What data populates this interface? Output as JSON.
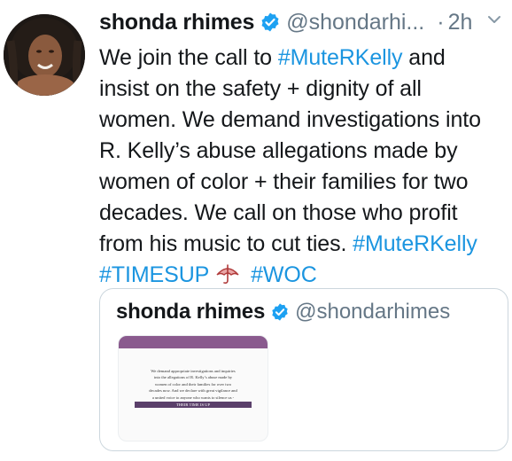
{
  "tweet": {
    "author_name": "shonda rhimes",
    "handle": "@shondarhi...",
    "dot": "·",
    "time": "2h",
    "lines": [
      [
        {
          "t": "We join the call to "
        },
        {
          "t": "#MuteRKelly",
          "h": true
        },
        {
          "t": " and"
        }
      ],
      [
        {
          "t": "insist on the safety + dignity of all"
        }
      ],
      [
        {
          "t": "women. We demand investigations into"
        }
      ],
      [
        {
          "t": "R. Kelly’s abuse allegations made by"
        }
      ],
      [
        {
          "t": "women of color + their families for two"
        }
      ],
      [
        {
          "t": "decades. We call on those who profit"
        }
      ],
      [
        {
          "t": "from his music to cut ties. "
        },
        {
          "t": "#MuteRKelly",
          "h": true
        }
      ],
      [
        {
          "t": "#TIMESUP",
          "h": true
        },
        {
          "emoji": "umbrella"
        },
        {
          "t": " "
        },
        {
          "t": "#WOC",
          "h": true
        }
      ]
    ]
  },
  "quoted_tweet": {
    "author_name": "shonda rhimes",
    "handle": "@shondarhimes",
    "image_text": [
      "We demand appropriate investigations and inquiries",
      "into the allegations of R. Kelly’s abuse made by",
      "women of color and their families for over two",
      "decades now. And we declare with great vigilance and",
      "a united voice to anyone who wants to silence us -"
    ],
    "image_stamp": "THEIR TIME IS UP"
  },
  "colors": {
    "link": "#1b95e0",
    "verified": "#1da1f2",
    "muted": "#657786",
    "image_bar": "#8a5a8e"
  },
  "icons": {
    "verified": "verified-badge-icon",
    "caret": "chevron-down-icon",
    "emoji": "umbrella-emoji"
  }
}
